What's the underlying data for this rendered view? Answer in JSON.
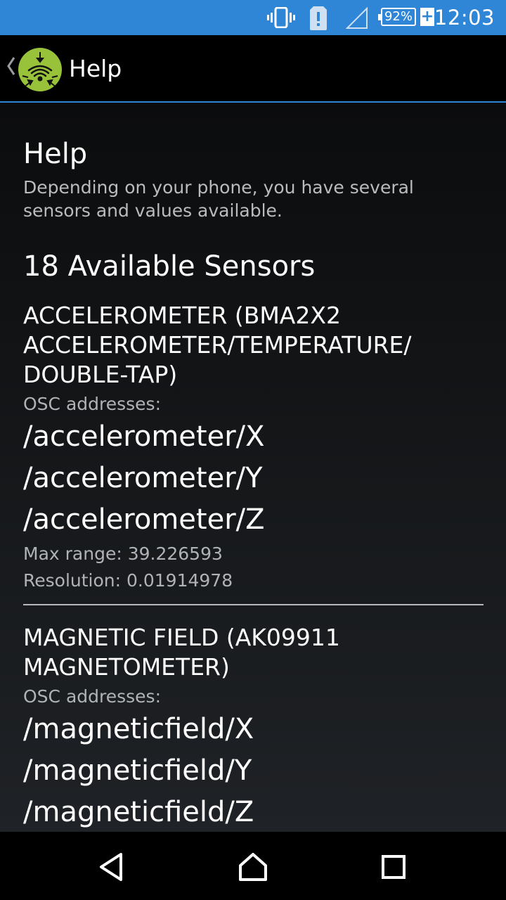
{
  "status_bar": {
    "time": "12:03",
    "battery_percent": "92%",
    "icons": [
      "vibrate-icon",
      "sim-alert-icon",
      "signal-icon",
      "battery-icon",
      "charging-plus-icon"
    ]
  },
  "action_bar": {
    "title": "Help",
    "app_icon": "wifi-sensor-app-icon"
  },
  "help": {
    "title": "Help",
    "description": "Depending on your phone, you have several sensors and values available."
  },
  "sensors_heading": "18 Available Sensors",
  "sensors": [
    {
      "name": "ACCELEROMETER (BMA2X2 ACCELEROMETER/TEMPERATURE/ DOUBLE-TAP)",
      "osc_label": "OSC addresses:",
      "addresses": [
        "/accelerometer/X",
        "/accelerometer/Y",
        "/accelerometer/Z"
      ],
      "max_range": "Max range: 39.226593",
      "resolution": "Resolution: 0.01914978"
    },
    {
      "name": "MAGNETIC FIELD (AK09911 MAGNETOMETER)",
      "osc_label": "OSC addresses:",
      "addresses": [
        "/magneticfield/X",
        "/magneticfield/Y",
        "/magneticfield/Z"
      ]
    }
  ],
  "nav_bar": {
    "icons": [
      "back-icon",
      "home-icon",
      "recent-apps-icon"
    ]
  }
}
